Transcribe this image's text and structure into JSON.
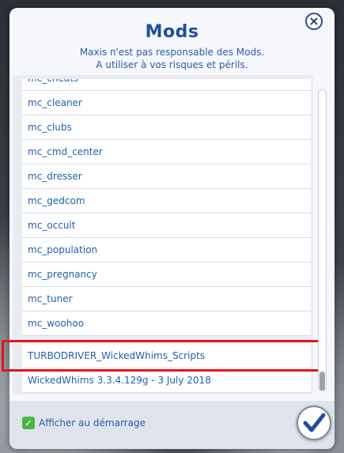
{
  "dialog": {
    "title": "Mods",
    "subtitle_line1": "Maxis n'est pas responsable des Mods.",
    "subtitle_line2": "A utiliser à vos risques et périls.",
    "close_icon": "close-icon"
  },
  "mods_list": {
    "partial_top_item": "mc_cheats",
    "items": [
      "mc_cleaner",
      "mc_clubs",
      "mc_cmd_center",
      "mc_dresser",
      "mc_gedcom",
      "mc_occult",
      "mc_population",
      "mc_pregnancy",
      "mc_tuner",
      "mc_woohoo",
      "TURBODRIVER_WickedWhims_Scripts",
      "WickedWhims 3.3.4.129g - 3 July 2018"
    ],
    "highlighted_item": "TURBODRIVER_WickedWhims_Scripts",
    "highlight_color": "#e3141e"
  },
  "footer": {
    "checkbox_label": "Afficher au démarrage",
    "checkbox_checked": true,
    "confirm_icon": "checkmark-icon"
  },
  "colors": {
    "accent_blue": "#1f4f9a",
    "link_blue": "#1f5fb0",
    "check_green": "#4bb543"
  }
}
